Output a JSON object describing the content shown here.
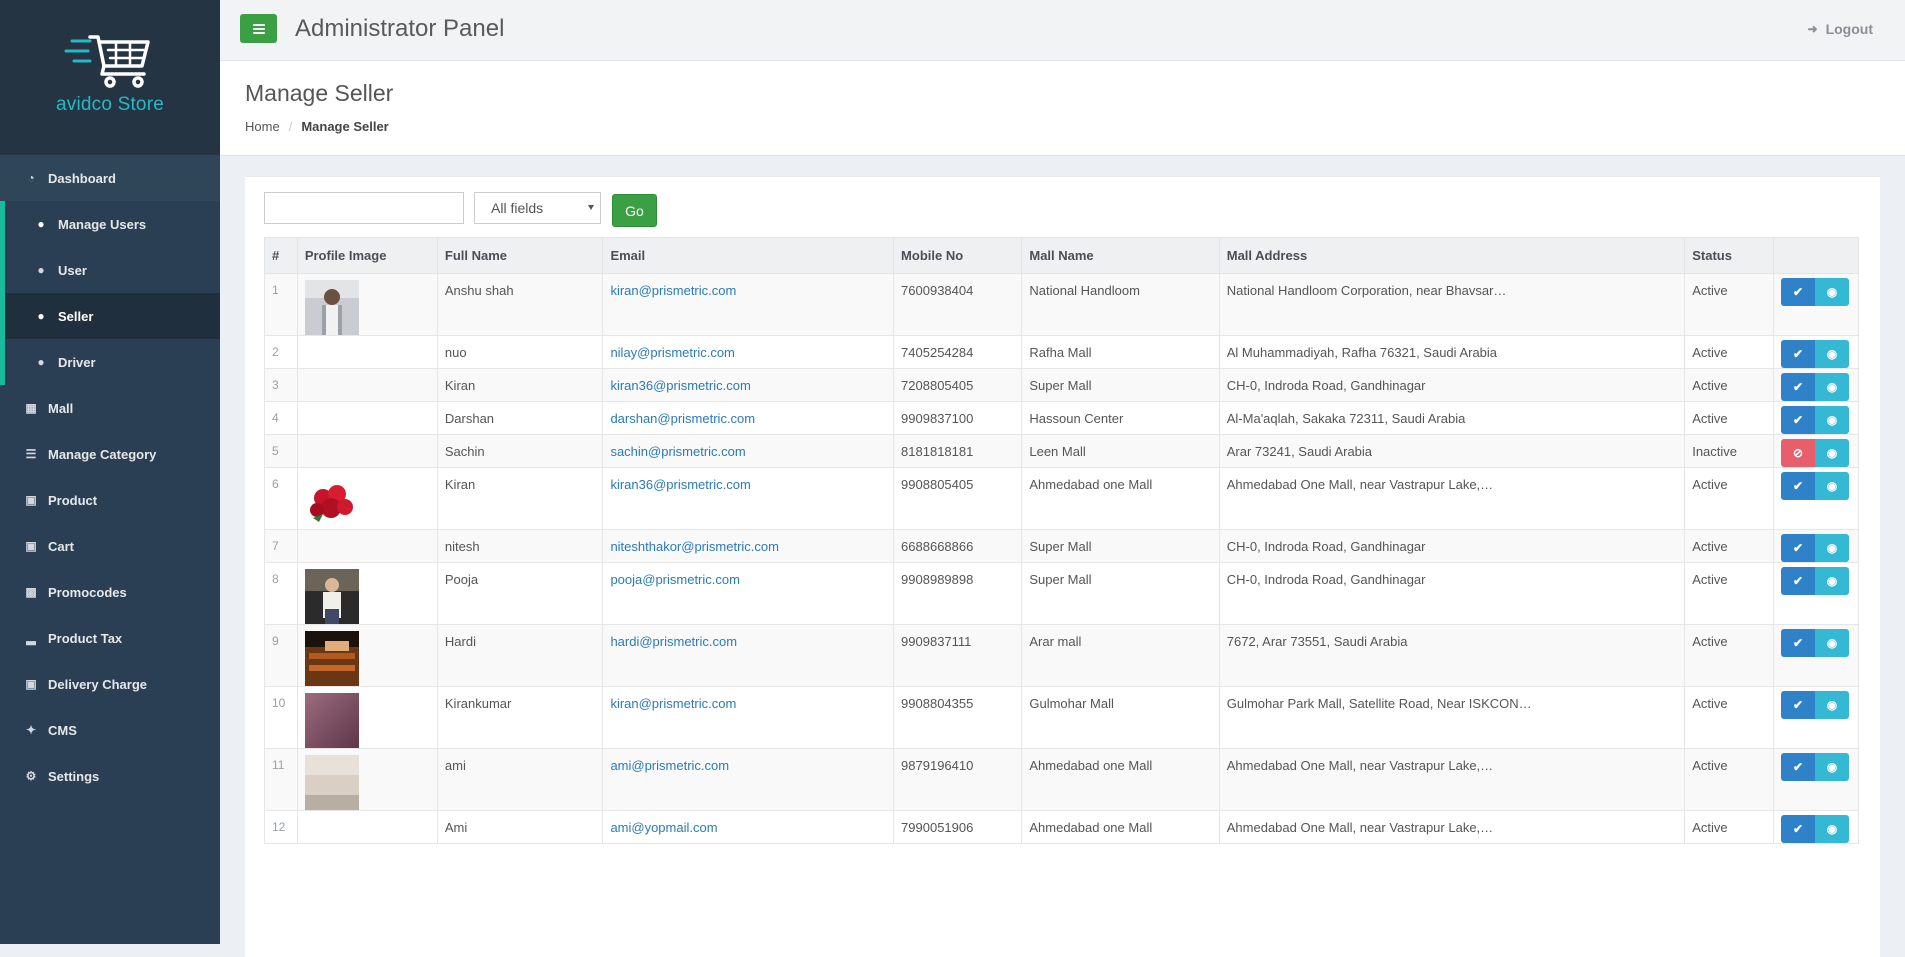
{
  "brand": {
    "name": "avidco Store"
  },
  "header": {
    "title": "Administrator Panel",
    "logout_label": "Logout"
  },
  "sidebar": {
    "items": [
      {
        "label": "Dashboard",
        "icon": "dashboard-icon"
      },
      {
        "label": "Manage Users",
        "icon": "users-icon"
      },
      {
        "label": "User",
        "icon": "user-icon"
      },
      {
        "label": "Seller",
        "icon": "user-icon"
      },
      {
        "label": "Driver",
        "icon": "user-icon"
      },
      {
        "label": "Mall",
        "icon": "grid-icon"
      },
      {
        "label": "Manage Category",
        "icon": "list-icon"
      },
      {
        "label": "Product",
        "icon": "cart-icon"
      },
      {
        "label": "Cart",
        "icon": "cart-icon"
      },
      {
        "label": "Promocodes",
        "icon": "gift-icon"
      },
      {
        "label": "Product Tax",
        "icon": "bar-chart-icon"
      },
      {
        "label": "Delivery Charge",
        "icon": "money-icon"
      },
      {
        "label": "CMS",
        "icon": "wrench-icon"
      },
      {
        "label": "Settings",
        "icon": "gear-icon"
      }
    ]
  },
  "page": {
    "title": "Manage Seller",
    "breadcrumb": {
      "home": "Home",
      "current": "Manage Seller"
    }
  },
  "search": {
    "value": "",
    "field_selected": "All fields",
    "go_label": "Go"
  },
  "table": {
    "columns": [
      "#",
      "Profile Image",
      "Full Name",
      "Email",
      "Mobile No",
      "Mall Name",
      "Mall Address",
      "Status",
      ""
    ],
    "rows": [
      {
        "num": "1",
        "image": "person",
        "name": "Anshu shah",
        "email": "kiran@prismetric.com",
        "mobile": "7600938404",
        "mall": "National Handloom",
        "address": "National Handloom Corporation, near Bhavsar…",
        "status": "Active"
      },
      {
        "num": "2",
        "image": "",
        "name": "nuo",
        "email": "nilay@prismetric.com",
        "mobile": "7405254284",
        "mall": "Rafha Mall",
        "address": "Al Muhammadiyah, Rafha 76321, Saudi Arabia",
        "status": "Active"
      },
      {
        "num": "3",
        "image": "",
        "name": "Kiran",
        "email": "kiran36@prismetric.com",
        "mobile": "7208805405",
        "mall": "Super Mall",
        "address": "CH-0, Indroda Road, Gandhinagar",
        "status": "Active"
      },
      {
        "num": "4",
        "image": "",
        "name": "Darshan",
        "email": "darshan@prismetric.com",
        "mobile": "9909837100",
        "mall": "Hassoun Center",
        "address": "Al-Ma'aqlah, Sakaka 72311, Saudi Arabia",
        "status": "Active"
      },
      {
        "num": "5",
        "image": "",
        "name": "Sachin",
        "email": "sachin@prismetric.com",
        "mobile": "8181818181",
        "mall": "Leen Mall",
        "address": "Arar 73241, Saudi Arabia",
        "status": "Inactive"
      },
      {
        "num": "6",
        "image": "roses",
        "name": "Kiran",
        "email": "kiran36@prismetric.com",
        "mobile": "9908805405",
        "mall": "Ahmedabad one Mall",
        "address": "Ahmedabad One Mall, near Vastrapur Lake,…",
        "status": "Active"
      },
      {
        "num": "7",
        "image": "",
        "name": "nitesh",
        "email": "niteshthakor@prismetric.com",
        "mobile": "6688668866",
        "mall": "Super Mall",
        "address": "CH-0, Indroda Road, Gandhinagar",
        "status": "Active"
      },
      {
        "num": "8",
        "image": "person-dark",
        "name": "Pooja",
        "email": "pooja@prismetric.com",
        "mobile": "9908989898",
        "mall": "Super Mall",
        "address": "CH-0, Indroda Road, Gandhinagar",
        "status": "Active"
      },
      {
        "num": "9",
        "image": "desk",
        "name": "Hardi",
        "email": "hardi@prismetric.com",
        "mobile": "9909837111",
        "mall": "Arar mall",
        "address": "7672, Arar 73551, Saudi Arabia",
        "status": "Active"
      },
      {
        "num": "10",
        "image": "mauve",
        "name": "Kirankumar",
        "email": "kiran@prismetric.com",
        "mobile": "9908804355",
        "mall": "Gulmohar Mall",
        "address": "Gulmohar Park Mall, Satellite Road, Near ISKCON…",
        "status": "Active"
      },
      {
        "num": "11",
        "image": "wall",
        "name": "ami",
        "email": "ami@prismetric.com",
        "mobile": "9879196410",
        "mall": "Ahmedabad one Mall",
        "address": "Ahmedabad One Mall, near Vastrapur Lake,…",
        "status": "Active"
      },
      {
        "num": "12",
        "image": "",
        "name": "Ami",
        "email": "ami@yopmail.com",
        "mobile": "7990051906",
        "mall": "Ahmedabad one Mall",
        "address": "Ahmedabad One Mall, near Vastrapur Lake,…",
        "status": "Active"
      }
    ]
  },
  "colors": {
    "accent": "#3aa043",
    "sidebar_bg": "#2a3f54",
    "active_border": "#1abb9c",
    "approve": "#2f82c8",
    "view": "#34b8d4",
    "block": "#e95e6b",
    "link": "#2a7ab8"
  }
}
